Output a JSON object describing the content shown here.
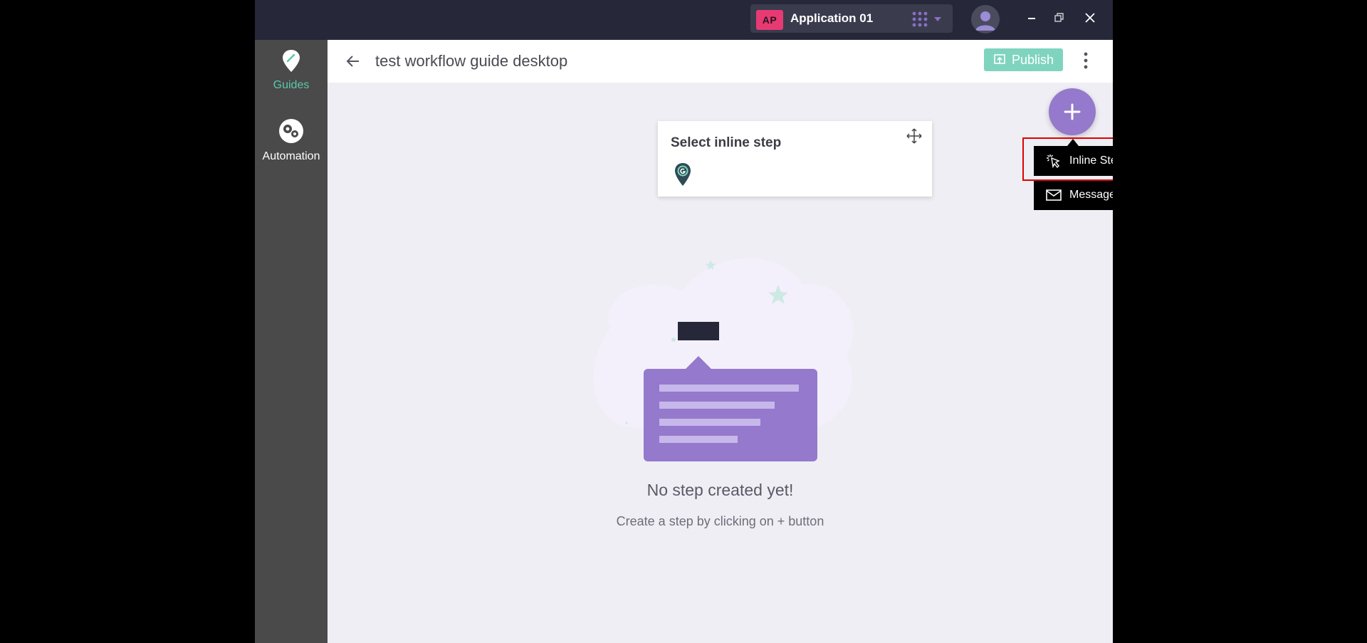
{
  "titlebar": {
    "app_badge": "AP",
    "app_name": "Application 01",
    "badge_color": "#e83a72"
  },
  "sidebar": {
    "items": [
      {
        "label": "Guides",
        "icon": "guides-icon",
        "active": true,
        "color": "#5cc7a8"
      },
      {
        "label": "Automation",
        "icon": "automation-icon",
        "active": false,
        "color": "#ffffff"
      }
    ]
  },
  "header": {
    "title": "test workflow guide desktop",
    "publish_label": "Publish"
  },
  "popup": {
    "title": "Select inline step"
  },
  "add_menu": {
    "items": [
      {
        "label": "Inline Step",
        "icon": "cursor-click-icon"
      },
      {
        "label": "Message Step",
        "icon": "envelope-icon"
      }
    ]
  },
  "empty_state": {
    "title": "No step created yet!",
    "subtitle": "Create a step by clicking on + button"
  },
  "colors": {
    "accent": "#9579cc",
    "publish": "#7fd4bf",
    "titlebar": "#262839",
    "sidebar": "#4a4a4a",
    "highlight": "#e00000"
  }
}
